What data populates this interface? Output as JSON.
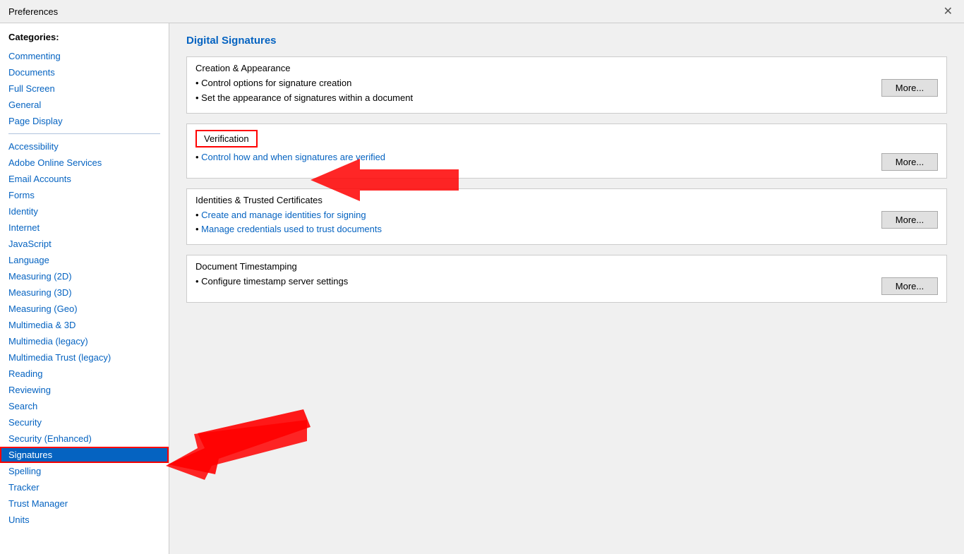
{
  "titleBar": {
    "title": "Preferences",
    "closeLabel": "✕"
  },
  "sidebar": {
    "categoriesLabel": "Categories:",
    "items": [
      {
        "label": "Commenting",
        "id": "commenting",
        "active": false,
        "topGroup": true
      },
      {
        "label": "Documents",
        "id": "documents",
        "active": false,
        "topGroup": true
      },
      {
        "label": "Full Screen",
        "id": "full-screen",
        "active": false,
        "topGroup": true
      },
      {
        "label": "General",
        "id": "general",
        "active": false,
        "topGroup": true
      },
      {
        "label": "Page Display",
        "id": "page-display",
        "active": false,
        "topGroup": true
      },
      {
        "label": "Accessibility",
        "id": "accessibility",
        "active": false,
        "topGroup": false
      },
      {
        "label": "Adobe Online Services",
        "id": "adobe-online-services",
        "active": false,
        "topGroup": false
      },
      {
        "label": "Email Accounts",
        "id": "email-accounts",
        "active": false,
        "topGroup": false
      },
      {
        "label": "Forms",
        "id": "forms",
        "active": false,
        "topGroup": false
      },
      {
        "label": "Identity",
        "id": "identity",
        "active": false,
        "topGroup": false
      },
      {
        "label": "Internet",
        "id": "internet",
        "active": false,
        "topGroup": false
      },
      {
        "label": "JavaScript",
        "id": "javascript",
        "active": false,
        "topGroup": false
      },
      {
        "label": "Language",
        "id": "language",
        "active": false,
        "topGroup": false
      },
      {
        "label": "Measuring (2D)",
        "id": "measuring-2d",
        "active": false,
        "topGroup": false
      },
      {
        "label": "Measuring (3D)",
        "id": "measuring-3d",
        "active": false,
        "topGroup": false
      },
      {
        "label": "Measuring (Geo)",
        "id": "measuring-geo",
        "active": false,
        "topGroup": false
      },
      {
        "label": "Multimedia & 3D",
        "id": "multimedia-3d",
        "active": false,
        "topGroup": false
      },
      {
        "label": "Multimedia (legacy)",
        "id": "multimedia-legacy",
        "active": false,
        "topGroup": false
      },
      {
        "label": "Multimedia Trust (legacy)",
        "id": "multimedia-trust-legacy",
        "active": false,
        "topGroup": false
      },
      {
        "label": "Reading",
        "id": "reading",
        "active": false,
        "topGroup": false
      },
      {
        "label": "Reviewing",
        "id": "reviewing",
        "active": false,
        "topGroup": false
      },
      {
        "label": "Search",
        "id": "search",
        "active": false,
        "topGroup": false
      },
      {
        "label": "Security",
        "id": "security",
        "active": false,
        "topGroup": false
      },
      {
        "label": "Security (Enhanced)",
        "id": "security-enhanced",
        "active": false,
        "topGroup": false
      },
      {
        "label": "Signatures",
        "id": "signatures",
        "active": true,
        "topGroup": false
      },
      {
        "label": "Spelling",
        "id": "spelling",
        "active": false,
        "topGroup": false
      },
      {
        "label": "Tracker",
        "id": "tracker",
        "active": false,
        "topGroup": false
      },
      {
        "label": "Trust Manager",
        "id": "trust-manager",
        "active": false,
        "topGroup": false
      },
      {
        "label": "Units",
        "id": "units",
        "active": false,
        "topGroup": false
      }
    ]
  },
  "main": {
    "pageTitle": "Digital Signatures",
    "sections": [
      {
        "id": "creation-appearance",
        "header": "Creation & Appearance",
        "bullets": [
          "Control options for signature creation",
          "Set the appearance of signatures within a document"
        ],
        "moreLabel": "More...",
        "isVerification": false
      },
      {
        "id": "verification",
        "header": "Verification",
        "bullets": [
          "Control how and when signatures are verified"
        ],
        "moreLabel": "More...",
        "isVerification": true
      },
      {
        "id": "identities-trusted",
        "header": "Identities & Trusted Certificates",
        "bullets": [
          "Create and manage identities for signing",
          "Manage credentials used to trust documents"
        ],
        "moreLabel": "More...",
        "isVerification": false
      },
      {
        "id": "document-timestamping",
        "header": "Document Timestamping",
        "bullets": [
          "Configure timestamp server settings"
        ],
        "moreLabel": "More...",
        "isVerification": false
      }
    ]
  }
}
